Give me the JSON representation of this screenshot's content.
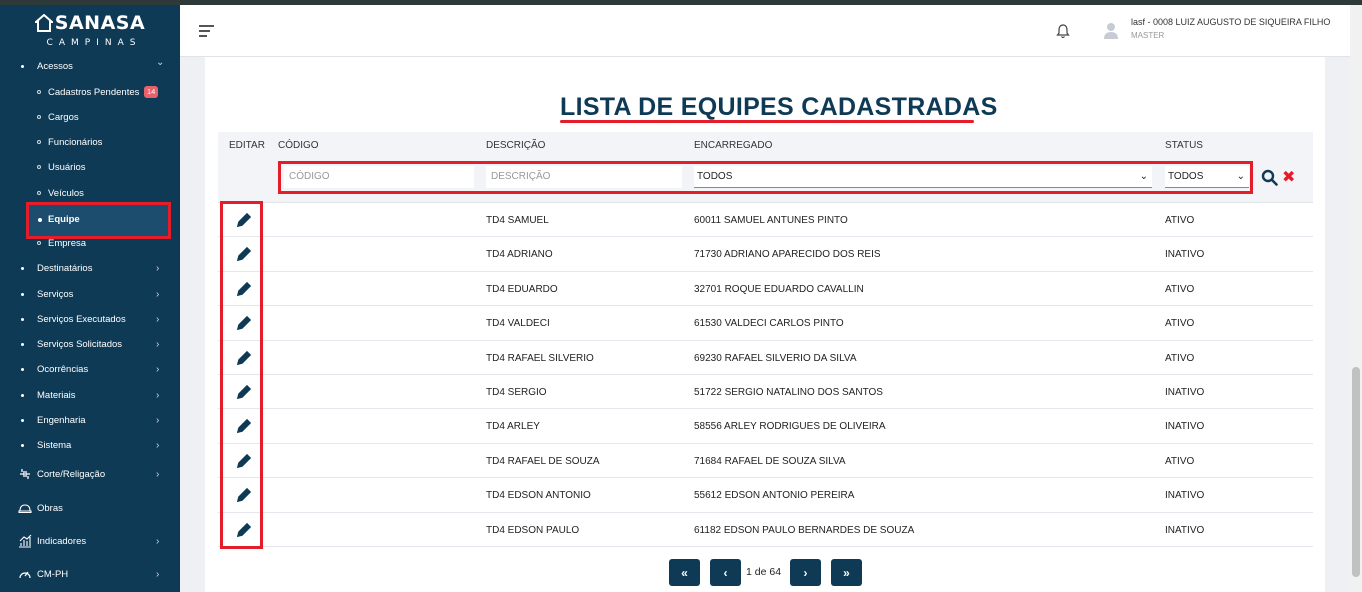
{
  "brand": {
    "name": "SANASA",
    "sub": "CAMPINAS"
  },
  "sidebar": {
    "acessos": {
      "label": "Acessos",
      "chevron": "⌄"
    },
    "sub_items": [
      {
        "label": "Cadastros Pendentes",
        "badge": "14"
      },
      {
        "label": "Cargos"
      },
      {
        "label": "Funcionários"
      },
      {
        "label": "Usuários"
      },
      {
        "label": "Veículos"
      },
      {
        "label": "Equipe"
      },
      {
        "label": "Empresa"
      }
    ],
    "items": [
      {
        "label": "Destinatários"
      },
      {
        "label": "Serviços"
      },
      {
        "label": "Serviços Executados"
      },
      {
        "label": "Serviços Solicitados"
      },
      {
        "label": "Ocorrências"
      },
      {
        "label": "Materiais"
      },
      {
        "label": "Engenharia"
      },
      {
        "label": "Sistema"
      }
    ],
    "icon_items": [
      {
        "label": "Corte/Religação",
        "icon": "plug-icon"
      },
      {
        "label": "Obras",
        "icon": "hardhat-icon"
      },
      {
        "label": "Indicadores",
        "icon": "chart-icon"
      },
      {
        "label": "CM-PH",
        "icon": "gauge-icon"
      }
    ],
    "chevron": "›"
  },
  "header": {
    "user_name": "lasf - 0008 LUIZ AUGUSTO DE SIQUEIRA FILHO",
    "user_role": "MASTER"
  },
  "page": {
    "title": "LISTA DE EQUIPES CADASTRADAS"
  },
  "table": {
    "headers": {
      "editar": "EDITAR",
      "codigo": "CÓDIGO",
      "descricao": "DESCRIÇÃO",
      "encarregado": "ENCARREGADO",
      "status": "STATUS"
    },
    "filters": {
      "codigo_placeholder": "CÓDIGO",
      "descricao_placeholder": "DESCRIÇÃO",
      "encarregado_value": "TODOS",
      "status_value": "TODOS"
    },
    "rows": [
      {
        "codigo": "",
        "descricao": "TD4 SAMUEL",
        "encarregado": "60011 SAMUEL ANTUNES PINTO",
        "status": "ATIVO"
      },
      {
        "codigo": "",
        "descricao": "TD4 ADRIANO",
        "encarregado": "71730 ADRIANO APARECIDO DOS REIS",
        "status": "INATIVO"
      },
      {
        "codigo": "",
        "descricao": "TD4 EDUARDO",
        "encarregado": "32701 ROQUE EDUARDO CAVALLIN",
        "status": "ATIVO"
      },
      {
        "codigo": "",
        "descricao": "TD4 VALDECI",
        "encarregado": "61530 VALDECI CARLOS PINTO",
        "status": "ATIVO"
      },
      {
        "codigo": "",
        "descricao": "TD4 RAFAEL SILVERIO",
        "encarregado": "69230 RAFAEL SILVERIO DA SILVA",
        "status": "ATIVO"
      },
      {
        "codigo": "",
        "descricao": "TD4 SERGIO",
        "encarregado": "51722 SERGIO NATALINO DOS SANTOS",
        "status": "INATIVO"
      },
      {
        "codigo": "",
        "descricao": "TD4 ARLEY",
        "encarregado": "58556 ARLEY RODRIGUES DE OLIVEIRA",
        "status": "INATIVO"
      },
      {
        "codigo": "",
        "descricao": "TD4 RAFAEL DE SOUZA",
        "encarregado": "71684 RAFAEL DE SOUZA SILVA",
        "status": "ATIVO"
      },
      {
        "codigo": "",
        "descricao": "TD4 EDSON ANTONIO",
        "encarregado": "55612 EDSON ANTONIO PEREIRA",
        "status": "INATIVO"
      },
      {
        "codigo": "",
        "descricao": "TD4 EDSON PAULO",
        "encarregado": "61182 EDSON PAULO BERNARDES DE SOUZA",
        "status": "INATIVO"
      }
    ]
  },
  "pagination": {
    "first": "«",
    "prev": "‹",
    "info": "1 de 64",
    "next": "›",
    "last": "»"
  },
  "colors": {
    "primary": "#0f3a56",
    "highlight": "#e31e2a",
    "badge": "#e8626b"
  }
}
